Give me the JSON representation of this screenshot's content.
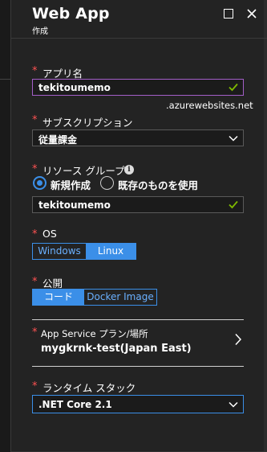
{
  "header": {
    "title": "Web App",
    "subtitle": "作成",
    "maximize_label": "maximize",
    "close_label": "close"
  },
  "app_name": {
    "label": "アプリ名",
    "value": "tekitoumemo",
    "suffix": ".azurewebsites.net",
    "valid": true
  },
  "subscription": {
    "label": "サブスクリプション",
    "selected": "従量課金"
  },
  "resource_group": {
    "label": "リソース グループ",
    "info_icon": "info-icon",
    "options": [
      "新規作成",
      "既存のものを使用"
    ],
    "selected_index": 0,
    "value": "tekitoumemo",
    "valid": true
  },
  "os": {
    "label": "OS",
    "options": [
      "Windows",
      "Linux"
    ],
    "selected_index": 1
  },
  "publish": {
    "label": "公開",
    "options": [
      "コード",
      "Docker Image"
    ],
    "selected_index": 0
  },
  "app_service_plan": {
    "label": "App Service プラン/場所",
    "value": "mygkrnk-test(Japan East)"
  },
  "runtime_stack": {
    "label": "ランタイム スタック",
    "selected": ".NET Core 2.1"
  },
  "required_marker": "*",
  "colors": {
    "background": "#232323",
    "accent": "#3b8fe8",
    "required": "#ff5252",
    "valid_check": "#7fba00",
    "focus_border": "#a35fc8"
  }
}
